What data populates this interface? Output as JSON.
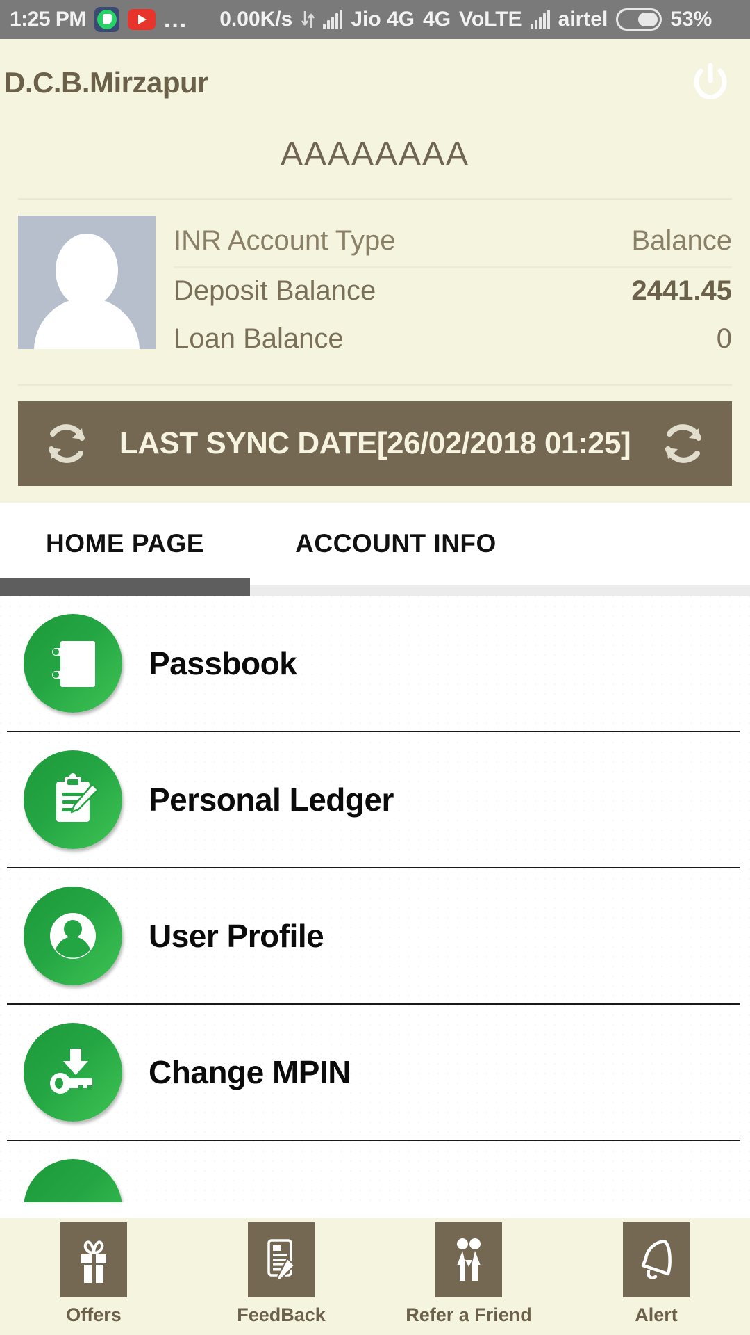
{
  "status_bar": {
    "time": "1:25 PM",
    "app_icons": [
      "whatsapp-icon",
      "youtube-icon"
    ],
    "overflow": "...",
    "data_speed": "0.00K/s",
    "transfer_icon": "up-down-arrows-icon",
    "sim1_signal_icon": "signal-bars-icon",
    "sim1_label": "Jio 4G",
    "network_type": "4G",
    "volte": "VoLTE",
    "sim2_signal_icon": "signal-bars-icon",
    "sim2_label": "airtel",
    "battery_icon": "battery-icon",
    "battery_percent": "53%"
  },
  "header": {
    "app_title": "D.C.B.Mirzapur",
    "power_icon": "power-icon",
    "account_name": "AAAAAAAA"
  },
  "account": {
    "avatar_icon": "user-avatar-placeholder",
    "header_row": {
      "label": "INR Account Type",
      "value": "Balance"
    },
    "rows": [
      {
        "label": "Deposit Balance",
        "value": "2441.45"
      },
      {
        "label": "Loan Balance",
        "value": "0"
      }
    ]
  },
  "sync": {
    "left_icon": "refresh-icon",
    "right_icon": "refresh-icon",
    "text": "LAST SYNC DATE[26/02/2018 01:25]",
    "bar_color": "#756852"
  },
  "tabs": {
    "items": [
      {
        "label": "HOME PAGE",
        "active": true
      },
      {
        "label": "ACCOUNT INFO",
        "active": false
      }
    ],
    "indicator_color": "#5E5E5E"
  },
  "menu": {
    "accent_color": "#24A543",
    "items": [
      {
        "label": "Passbook",
        "icon": "passbook-icon"
      },
      {
        "label": "Personal Ledger",
        "icon": "clipboard-pencil-icon"
      },
      {
        "label": "User Profile",
        "icon": "user-profile-icon"
      },
      {
        "label": "Change MPIN",
        "icon": "key-download-icon"
      }
    ]
  },
  "bottom_nav": {
    "items": [
      {
        "label": "Offers",
        "icon": "gift-icon"
      },
      {
        "label": "FeedBack",
        "icon": "document-pencil-icon"
      },
      {
        "label": "Refer a Friend",
        "icon": "two-people-icon"
      },
      {
        "label": "Alert",
        "icon": "bell-icon"
      }
    ],
    "tile_color": "#756852"
  },
  "theme": {
    "cream": "#F5F4DE",
    "brown": "#756852",
    "brown_text": "#6B6049",
    "green_dark": "#1E9A3B",
    "green_light": "#3EC454",
    "avatar_gray": "#B6BFCB"
  }
}
